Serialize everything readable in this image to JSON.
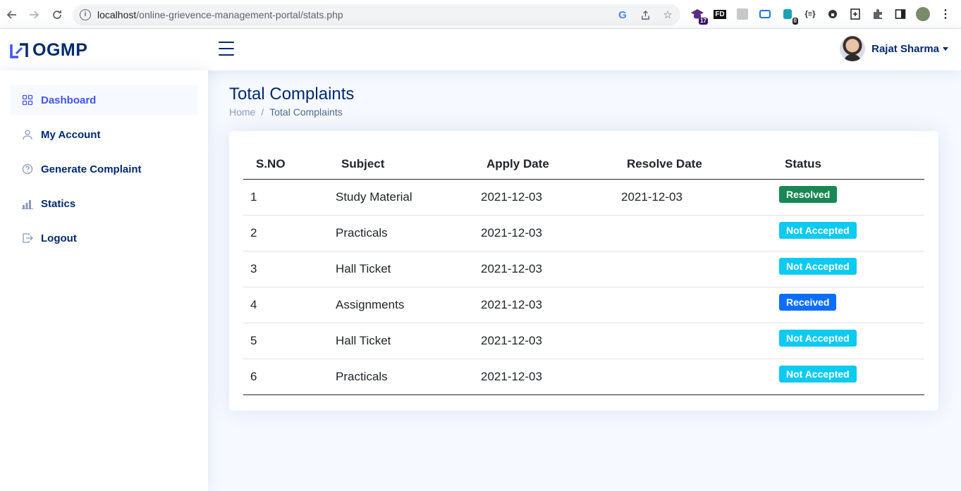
{
  "browser": {
    "url_host": "localhost",
    "url_path": "/online-grievence-management-portal/stats.php",
    "extensions": [
      {
        "icon": "graduation-cap-icon",
        "badge": "17"
      },
      {
        "icon": "fd-icon",
        "label": "FD"
      },
      {
        "icon": "script-icon"
      },
      {
        "icon": "screen-record-icon"
      },
      {
        "icon": "lock-person-icon",
        "badge": "0"
      },
      {
        "icon": "json-icon",
        "label": "{≡}"
      },
      {
        "icon": "lock-icon"
      },
      {
        "icon": "doc-plus-icon"
      },
      {
        "icon": "puzzle-icon"
      },
      {
        "icon": "sidepanel-icon"
      },
      {
        "icon": "profile-icon"
      },
      {
        "icon": "menu-dots-icon"
      }
    ]
  },
  "header": {
    "logo_text": "OGMP",
    "user_name": "Rajat Sharma"
  },
  "sidebar": {
    "items": [
      {
        "label": "Dashboard",
        "icon": "grid-icon",
        "active": true
      },
      {
        "label": "My Account",
        "icon": "person-icon",
        "active": false
      },
      {
        "label": "Generate Complaint",
        "icon": "question-circle-icon",
        "active": false
      },
      {
        "label": "Statics",
        "icon": "bar-chart-icon",
        "active": false
      },
      {
        "label": "Logout",
        "icon": "logout-icon",
        "active": false
      }
    ]
  },
  "main": {
    "title": "Total Complaints",
    "breadcrumb": {
      "home": "Home",
      "separator": "/",
      "current": "Total Complaints"
    },
    "table": {
      "headers": [
        "S.NO",
        "Subject",
        "Apply Date",
        "Resolve Date",
        "Status"
      ],
      "rows": [
        {
          "sno": "1",
          "subject": "Study Material",
          "apply": "2021-12-03",
          "resolve": "2021-12-03",
          "status": "Resolved",
          "status_color": "#198754"
        },
        {
          "sno": "2",
          "subject": "Practicals",
          "apply": "2021-12-03",
          "resolve": "",
          "status": "Not Accepted",
          "status_color": "#0dcaf0"
        },
        {
          "sno": "3",
          "subject": "Hall Ticket",
          "apply": "2021-12-03",
          "resolve": "",
          "status": "Not Accepted",
          "status_color": "#0dcaf0"
        },
        {
          "sno": "4",
          "subject": "Assignments",
          "apply": "2021-12-03",
          "resolve": "",
          "status": "Received",
          "status_color": "#0d6efd"
        },
        {
          "sno": "5",
          "subject": "Hall Ticket",
          "apply": "2021-12-03",
          "resolve": "",
          "status": "Not Accepted",
          "status_color": "#0dcaf0"
        },
        {
          "sno": "6",
          "subject": "Practicals",
          "apply": "2021-12-03",
          "resolve": "",
          "status": "Not Accepted",
          "status_color": "#0dcaf0"
        }
      ]
    }
  },
  "colors": {
    "brand": "#012970",
    "accent": "#4154f1",
    "muted": "#899bbd"
  }
}
